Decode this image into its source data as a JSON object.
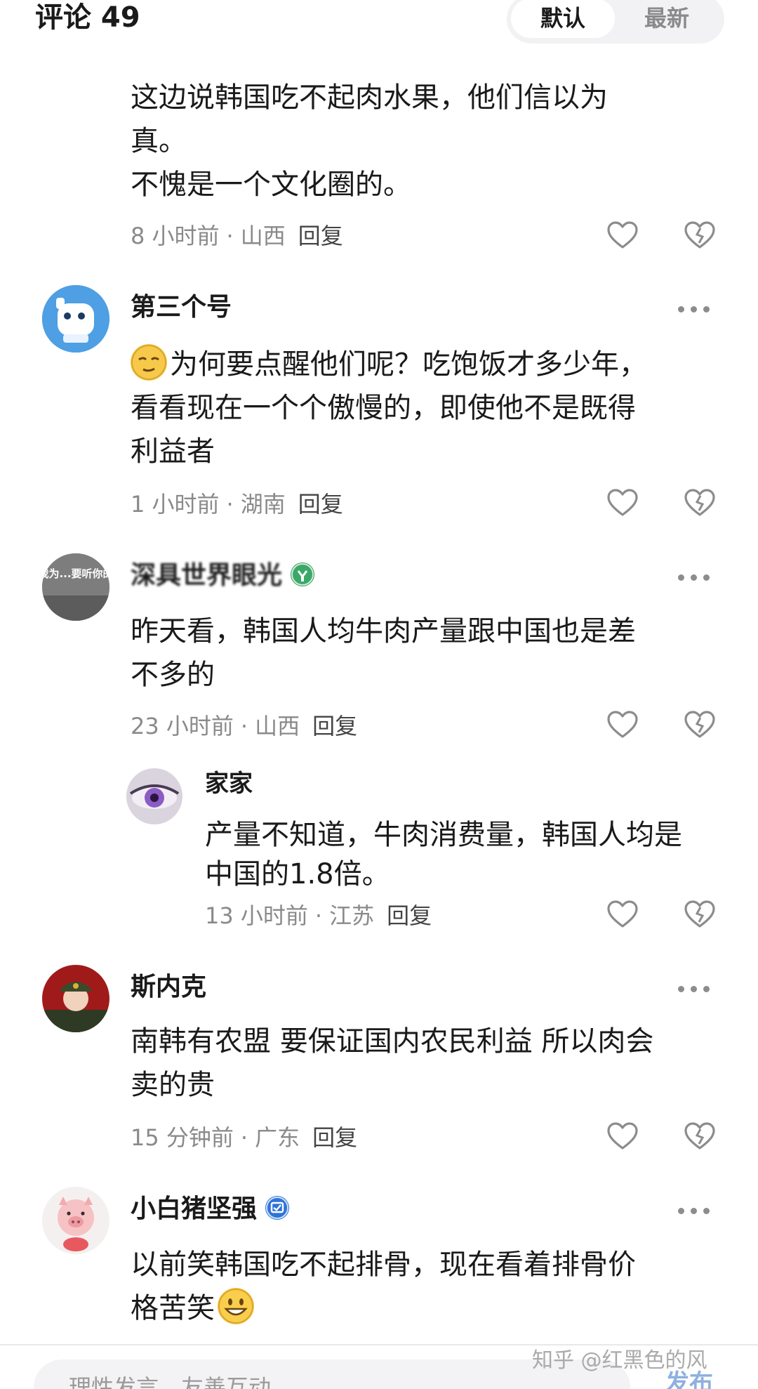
{
  "header": {
    "title": "评论 49",
    "sort_default": "默认",
    "sort_latest": "最新"
  },
  "comments": [
    {
      "lines": [
        "这边说韩国吃不起肉水果，他们信以为",
        "真。",
        "不愧是一个文化圈的。"
      ],
      "time": "8 小时前",
      "location": "山西",
      "reply": "回复"
    },
    {
      "user": "第三个号",
      "lines": [
        "为何要点醒他们呢？吃饱饭才多少年，",
        "看看现在一个个傲慢的，即使他不是既得",
        "利益者"
      ],
      "time": "1 小时前",
      "location": "湖南",
      "reply": "回复"
    },
    {
      "user": "深具世界眼光",
      "avatar_text": "我为...要听你的",
      "lines": [
        "昨天看，韩国人均牛肉产量跟中国也是差",
        "不多的"
      ],
      "time": "23 小时前",
      "location": "山西",
      "reply": "回复"
    },
    {
      "user": "家家",
      "lines": [
        "产量不知道，牛肉消费量，韩国人均是",
        "中国的1.8倍。"
      ],
      "time": "13 小时前",
      "location": "江苏",
      "reply": "回复"
    },
    {
      "user": "斯内克",
      "lines": [
        "南韩有农盟 要保证国内农民利益 所以肉会",
        "卖的贵"
      ],
      "time": "15 分钟前",
      "location": "广东",
      "reply": "回复"
    },
    {
      "user": "小白猪坚强",
      "lines": [
        "以前笑韩国吃不起排骨，现在看着排骨价",
        "格苦笑"
      ]
    }
  ],
  "composer": {
    "placeholder": "理性发言，友善互动",
    "send": "发布"
  },
  "watermark": "知乎 @红黑色的风",
  "colors": {
    "like_icon": "#8c8c8c",
    "text": "#1a1a1a",
    "meta": "#8a8a8a"
  }
}
